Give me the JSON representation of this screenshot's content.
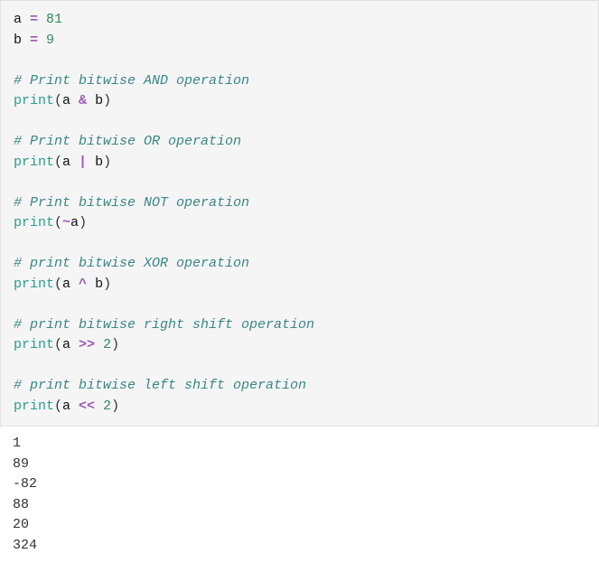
{
  "code": {
    "line1_var_a": "a",
    "line1_op": " = ",
    "line1_num": "81",
    "line2_var_b": "b",
    "line2_op": " = ",
    "line2_num": "9",
    "blank1": "",
    "comment1": "# Print bitwise AND operation",
    "print1_func": "print",
    "print1_lparen": "(",
    "print1_a": "a ",
    "print1_op": "&",
    "print1_b": " b",
    "print1_rparen": ")",
    "blank2": "",
    "comment2": "# Print bitwise OR operation",
    "print2_func": "print",
    "print2_lparen": "(",
    "print2_a": "a ",
    "print2_op": "|",
    "print2_b": " b",
    "print2_rparen": ")",
    "blank3": "",
    "comment3": "# Print bitwise NOT operation",
    "print3_func": "print",
    "print3_lparen": "(",
    "print3_op": "~",
    "print3_a": "a",
    "print3_rparen": ")",
    "blank4": "",
    "comment4": "# print bitwise XOR operation",
    "print4_func": "print",
    "print4_lparen": "(",
    "print4_a": "a ",
    "print4_op": "^",
    "print4_b": " b",
    "print4_rparen": ")",
    "blank5": "",
    "comment5": "# print bitwise right shift operation",
    "print5_func": "print",
    "print5_lparen": "(",
    "print5_a": "a ",
    "print5_op": ">>",
    "print5_n": " 2",
    "print5_rparen": ")",
    "blank6": "",
    "comment6": "# print bitwise left shift operation",
    "print6_func": "print",
    "print6_lparen": "(",
    "print6_a": "a ",
    "print6_op": "<<",
    "print6_n": " 2",
    "print6_rparen": ")"
  },
  "output": {
    "line1": "1",
    "line2": "89",
    "line3": "-82",
    "line4": "88",
    "line5": "20",
    "line6": "324"
  }
}
